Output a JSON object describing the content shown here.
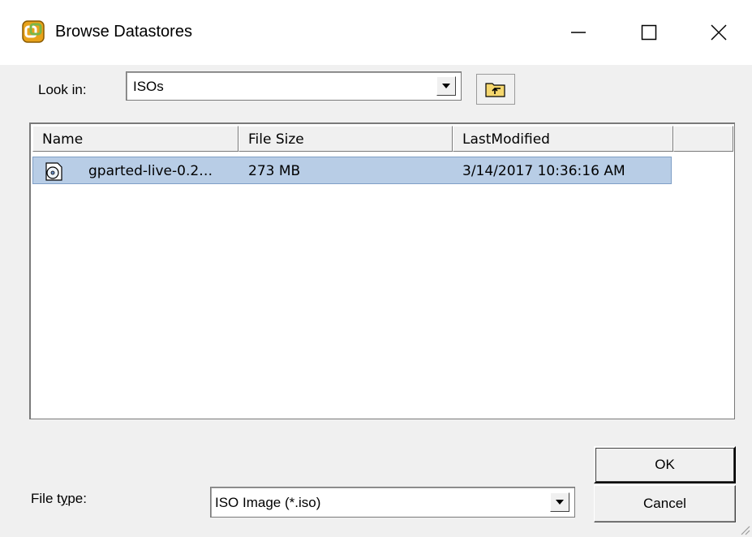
{
  "window": {
    "title": "Browse Datastores",
    "minimize_glyph": "—",
    "maximize_glyph": "☐",
    "close_glyph": "✕"
  },
  "lookin": {
    "label": "Look in:",
    "value": "ISOs"
  },
  "list": {
    "columns": [
      "Name",
      "File Size",
      "LastModified",
      ""
    ],
    "rows": [
      {
        "name": "gparted-live-0.2…",
        "size": "273 MB",
        "modified": "3/14/2017 10:36:16 AM",
        "selected": true,
        "icon": "iso-disc-icon"
      }
    ]
  },
  "filetype": {
    "label_prefix": "File t",
    "label_underlined": "y",
    "label_suffix": "pe:",
    "value": "ISO Image (*.iso)"
  },
  "buttons": {
    "ok": "OK",
    "cancel": "Cancel"
  },
  "colors": {
    "selection": "#b8cde6",
    "dialog_bg": "#f0f0f0"
  }
}
